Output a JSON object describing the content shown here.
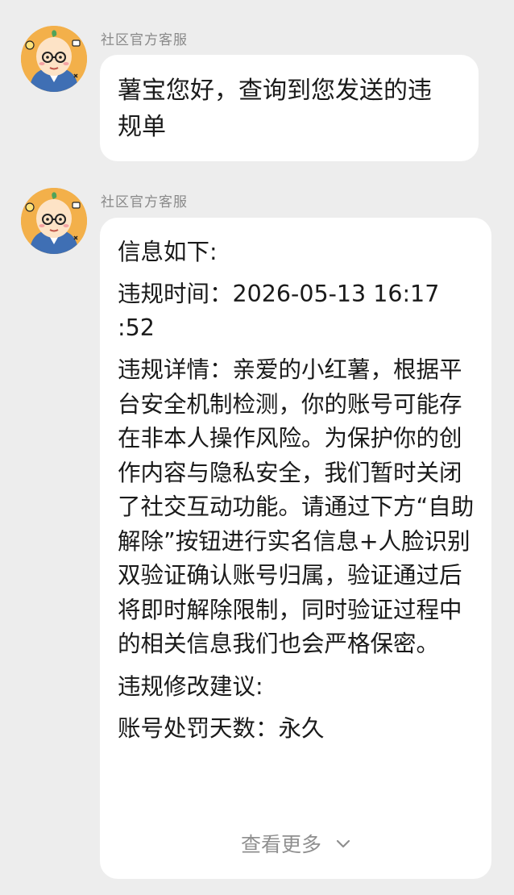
{
  "messages": [
    {
      "sender": "社区官方客服",
      "text_lines": [
        "薯宝您好，查询到您发送的违",
        "规单"
      ]
    },
    {
      "sender": "社区官方客服",
      "heading": "信息如下:",
      "violation_time": "违规时间：2026-05-13 16:17\n:52",
      "violation_detail": "违规详情：亲爱的小红薯，根据平台安全机制检测，你的账号可能存在非本人操作风险。为保护你的创作内容与隐私安全，我们暂时关闭了社交互动功能。请通过下方“自助解除”按钮进行实名信息+人脸识别双验证确认账号归属，验证通过后将即时解除限制，同时验证过程中的相关信息我们也会严格保密。",
      "suggestion": "违规修改建议:",
      "penalty_days": "账号处罚天数：永久",
      "view_more": "查看更多"
    }
  ],
  "icons": {
    "avatar": "potato-mascot-avatar-icon",
    "view_more_chevron": "chevron-down-icon"
  },
  "colors": {
    "background": "#ededed",
    "bubble": "#ffffff",
    "sender_text": "#8a8a8a",
    "avatar_bg": "#f3b04a"
  }
}
